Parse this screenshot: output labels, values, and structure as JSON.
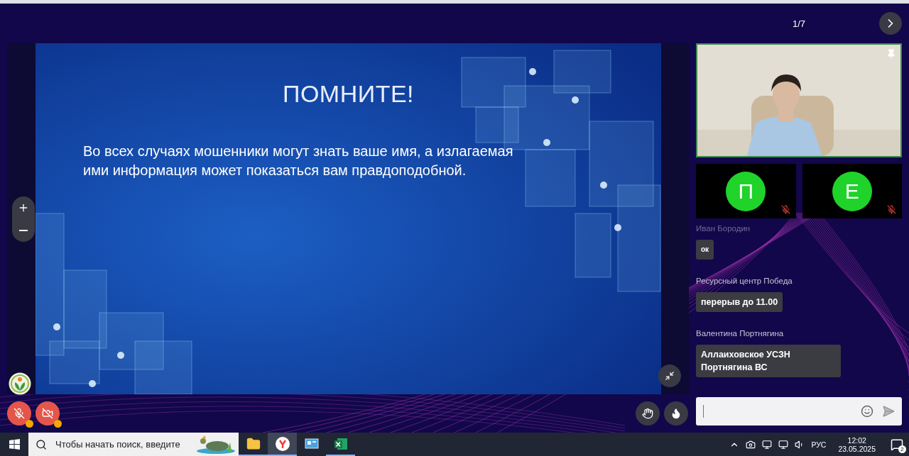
{
  "header": {
    "slide_counter": "1/7"
  },
  "slide": {
    "title": "ПОМНИТЕ!",
    "body": "Во всех случаях мошенники могут знать ваше имя, а излагаемая ими информация может показаться вам правдоподобной."
  },
  "participants": [
    {
      "kind": "video",
      "pinned": true
    },
    {
      "kind": "avatar",
      "initial": "П",
      "muted": true
    },
    {
      "kind": "avatar",
      "initial": "Е",
      "muted": true
    }
  ],
  "chat": {
    "messages": [
      {
        "author": "Иван Бородин",
        "text": "ок",
        "faded": true
      },
      {
        "author": "Ресурсный центр Победа",
        "text": "перерыв до 11.00",
        "faded": false
      },
      {
        "author": "Валентина Портнягина",
        "text": "Аллаиховское УСЗН Портнягина ВС",
        "faded": false
      }
    ]
  },
  "self_controls": {
    "mic_muted": true,
    "camera_off": true,
    "warnings": true
  },
  "taskbar": {
    "search_placeholder": "Чтобы начать поиск, введите",
    "apps": [
      {
        "kind": "folder",
        "selected": false,
        "running": true
      },
      {
        "kind": "browser",
        "selected": true,
        "running": true
      },
      {
        "kind": "display",
        "selected": false,
        "running": false
      },
      {
        "kind": "spreadsheet",
        "selected": false,
        "running": true
      }
    ],
    "language": "РУС",
    "time": "12:02",
    "date": "23.05.2025",
    "notifications": "2"
  }
}
